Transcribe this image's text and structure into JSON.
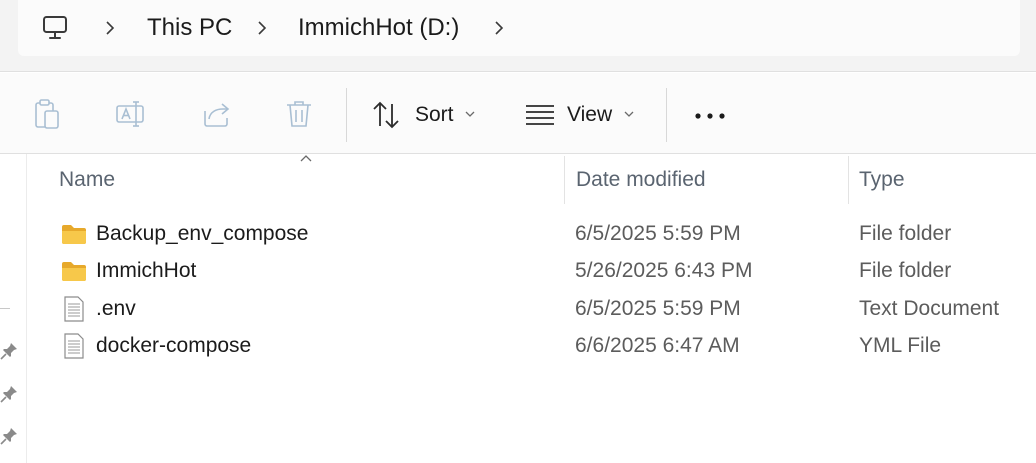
{
  "breadcrumb": {
    "items": [
      "This PC",
      "ImmichHot (D:)"
    ]
  },
  "toolbar": {
    "sort_label": "Sort",
    "view_label": "View",
    "more_label": "•••"
  },
  "columns": {
    "name": "Name",
    "date": "Date modified",
    "type": "Type"
  },
  "files": [
    {
      "name": "Backup_env_compose",
      "date": "6/5/2025 5:59 PM",
      "type": "File folder",
      "icon": "folder-icon"
    },
    {
      "name": "ImmichHot",
      "date": "5/26/2025 6:43 PM",
      "type": "File folder",
      "icon": "folder-icon"
    },
    {
      "name": ".env",
      "date": "6/5/2025 5:59 PM",
      "type": "Text Document",
      "icon": "document-icon"
    },
    {
      "name": "docker-compose",
      "date": "6/6/2025 6:47 AM",
      "type": "YML File",
      "icon": "document-icon"
    }
  ],
  "colors": {
    "folder": "#f7c84a",
    "folder_dark": "#e7a92b",
    "header_text": "#5a6470",
    "toolbar_disabled": "#9fb4c7"
  }
}
